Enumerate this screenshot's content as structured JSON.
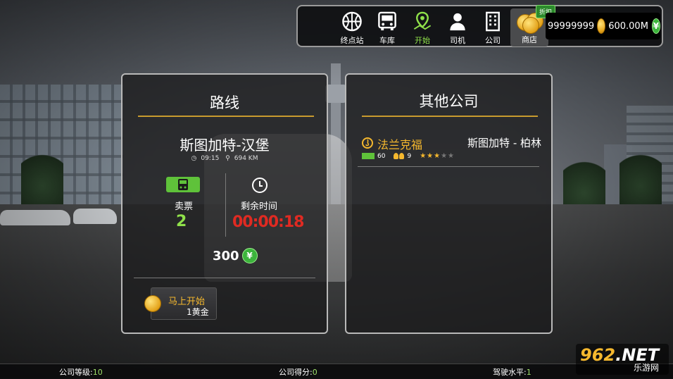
{
  "topbar": {
    "nav": [
      {
        "label": "终点站",
        "icon": "basketball-icon"
      },
      {
        "label": "车库",
        "icon": "bus-icon"
      },
      {
        "label": "开始",
        "icon": "map-pin-icon",
        "active": true
      },
      {
        "label": "司机",
        "icon": "driver-icon"
      },
      {
        "label": "公司",
        "icon": "building-icon"
      }
    ],
    "shop_label": "商店",
    "discount_label": "折扣",
    "gold_amount": "99999999",
    "cash_amount": "600.00M",
    "currency_symbol": "¥"
  },
  "route_panel": {
    "title": "路线",
    "route_name": "斯图加特-汉堡",
    "time": "09:15",
    "distance": "694 KM",
    "tickets_label": "卖票",
    "tickets_value": "2",
    "remaining_label": "剩余时间",
    "remaining_value": "00:00:18",
    "reward": "300",
    "start_button": {
      "line1": "马上开始",
      "line2": "1黄金"
    }
  },
  "other_panel": {
    "title": "其他公司",
    "companies": [
      {
        "name": "法兰克福",
        "route": "斯图加特 - 柏林",
        "level": "60",
        "drivers": "9",
        "stars": 3,
        "max_stars": 5
      }
    ]
  },
  "bottombar": {
    "company_level_label": "公司等级:",
    "company_level_value": "10",
    "company_score_label": "公司得分:",
    "company_score_value": "0",
    "driving_level_label": "驾驶水平:",
    "driving_level_value": "1"
  },
  "watermark": {
    "line1_a": "962",
    "line1_b": ".NET",
    "line2": "乐游网"
  },
  "colors": {
    "accent_green": "#8fe04a",
    "gold": "#f5b82e",
    "timer_red": "#e02a22",
    "title_line": "#c89b2e"
  }
}
